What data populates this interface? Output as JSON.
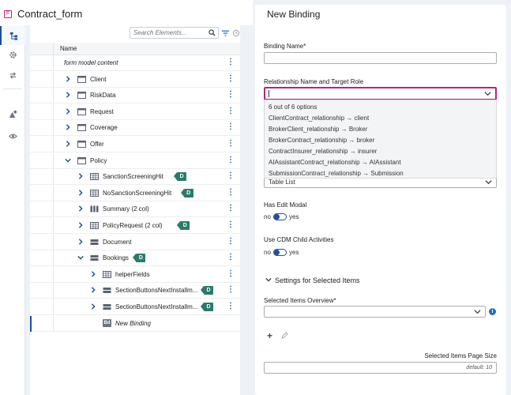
{
  "header": {
    "badge": "F",
    "title": "Contract_form"
  },
  "sidebar": {
    "icons": [
      "hierarchy-icon",
      "gear-icon",
      "arrows-icon",
      "shapes-icon",
      "eye-icon"
    ]
  },
  "tree": {
    "search_placeholder": "Search Elements...",
    "column_name": "Name",
    "rows": [
      {
        "label": "form model content",
        "icon": "none",
        "italic": true,
        "chevron": "none",
        "depth": 0,
        "badge": ""
      },
      {
        "label": "Client",
        "icon": "form-icon",
        "chevron": "right",
        "depth": 0,
        "badge": ""
      },
      {
        "label": "RiskData",
        "icon": "form-icon",
        "chevron": "right",
        "depth": 0,
        "badge": ""
      },
      {
        "label": "Request",
        "icon": "form-icon",
        "chevron": "right",
        "depth": 0,
        "badge": ""
      },
      {
        "label": "Coverage",
        "icon": "form-icon",
        "chevron": "right",
        "depth": 0,
        "badge": ""
      },
      {
        "label": "Offer",
        "icon": "form-icon",
        "chevron": "right",
        "depth": 0,
        "badge": ""
      },
      {
        "label": "Policy",
        "icon": "form-icon",
        "chevron": "down",
        "depth": 0,
        "badge": ""
      },
      {
        "label": "SanctionScreeningHit",
        "icon": "grid-icon",
        "chevron": "right",
        "depth": 1,
        "badge": "D"
      },
      {
        "label": "NoSanctionScreeningHit",
        "icon": "grid-icon",
        "chevron": "right",
        "depth": 1,
        "badge": "D"
      },
      {
        "label": "Summary (2 col)",
        "icon": "columns-icon",
        "chevron": "right",
        "depth": 1,
        "badge": ""
      },
      {
        "label": "PolicyRequest (2 col)",
        "icon": "grid-icon",
        "chevron": "right",
        "depth": 1,
        "badge": "D"
      },
      {
        "label": "Document",
        "icon": "list-icon",
        "chevron": "right",
        "depth": 1,
        "badge": ""
      },
      {
        "label": "Bookings",
        "icon": "list-icon",
        "chevron": "down",
        "depth": 1,
        "badge": "D"
      },
      {
        "label": "helperFields",
        "icon": "grid-icon",
        "chevron": "right",
        "depth": 2,
        "badge": ""
      },
      {
        "label": "SectionButtonsNextInstallm...",
        "icon": "list-icon",
        "chevron": "right",
        "depth": 2,
        "badge": "D"
      },
      {
        "label": "SectionButtonsNextInstallm...",
        "icon": "list-icon",
        "chevron": "right",
        "depth": 2,
        "badge": "D"
      },
      {
        "label": "New Binding",
        "icon": "bd-icon",
        "italic": true,
        "chevron": "none",
        "depth": 2,
        "badge": "",
        "selected": true
      }
    ],
    "bd_icon_text": "Bd"
  },
  "panel": {
    "title": "New Binding",
    "binding_name_label": "Binding Name*",
    "relationship_label": "Relationship Name and Target Role",
    "dropdown": {
      "count": "6 out of 6 options",
      "options": [
        "ClientContract_relationship → client",
        "BrokerClient_relationship → Broker",
        "BrokerContract_relationship → broker",
        "ContractInsurer_relationship → insurer",
        "AIAssistantContract_relationship → AIAssistant",
        "SubmissionContract_relationship → Submission"
      ]
    },
    "table_value": "Table List",
    "has_edit_modal_label": "Has Edit Modal",
    "use_cdm_label": "Use CDM Child Activities",
    "toggle_no": "no",
    "toggle_yes": "yes",
    "settings_title": "Settings for Selected Items",
    "overview_label": "Selected Items Overview*",
    "info_text": "i",
    "page_size_label": "Selected Items Page Size",
    "page_size_placeholder": "default: 10"
  },
  "colors": {
    "accent": "#1f4e99",
    "focus": "#b3257d",
    "badge": "#2c7a6b"
  }
}
